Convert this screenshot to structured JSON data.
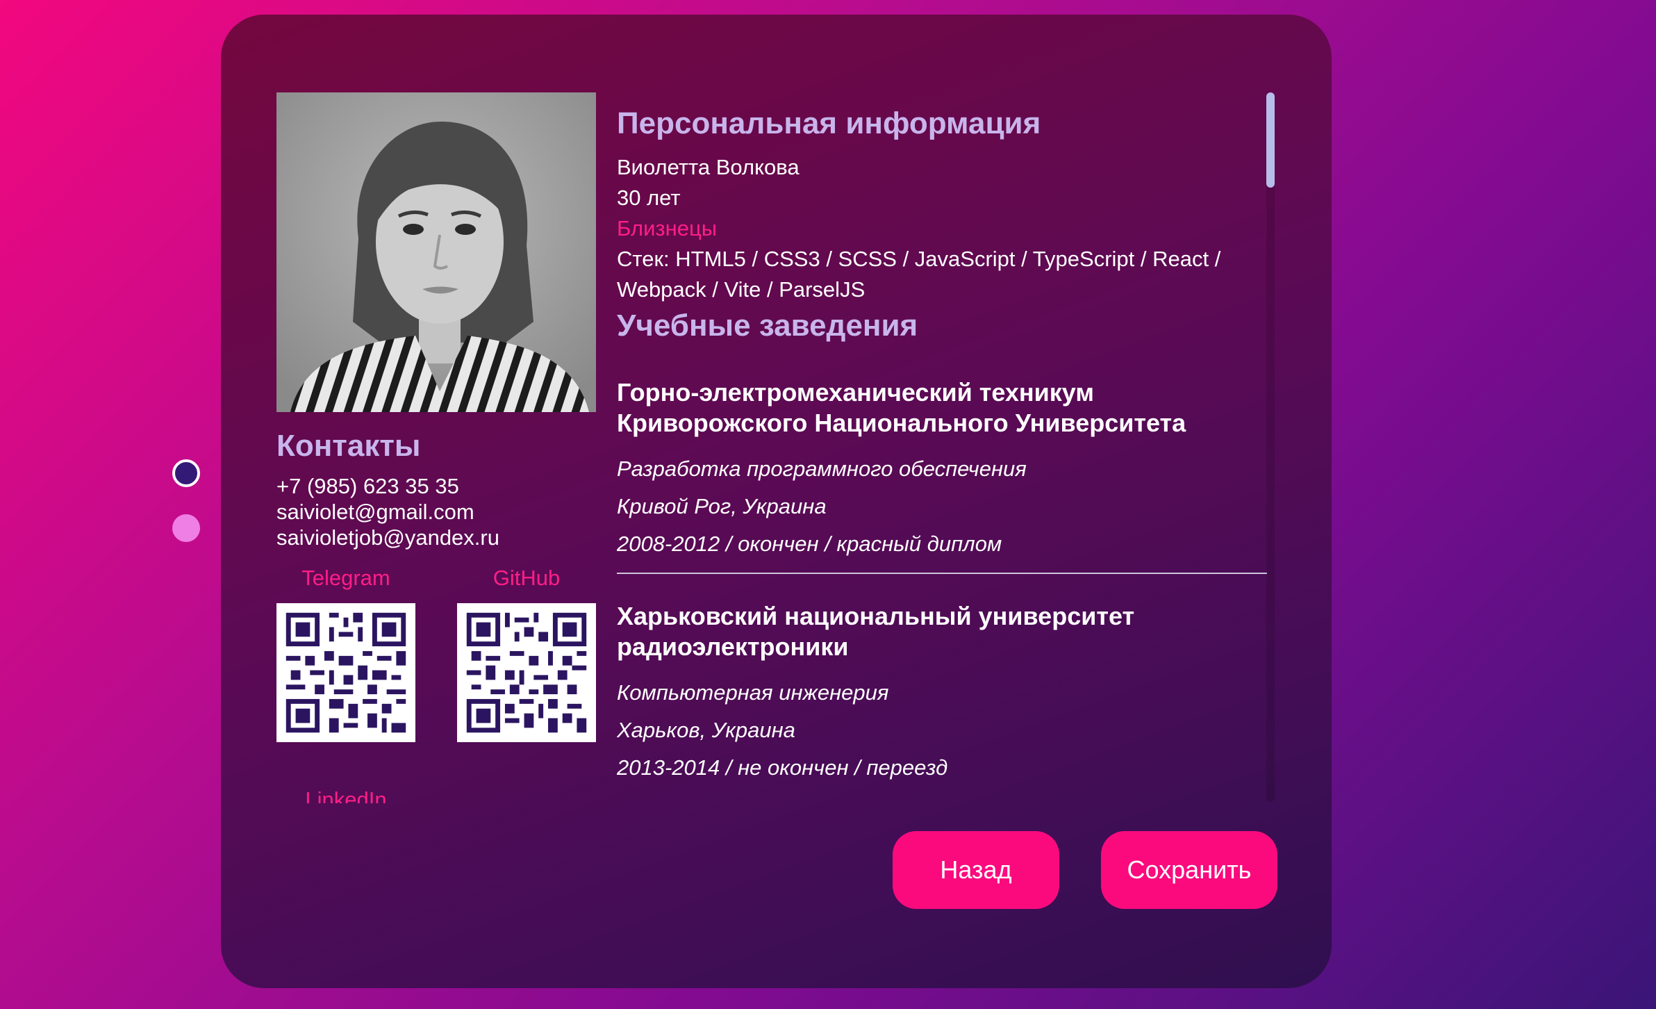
{
  "contacts": {
    "title": "Контакты",
    "phone": "+7 (985) 623 35 35",
    "email1": "saiviolet@gmail.com",
    "email2": "saivioletjob@yandex.ru",
    "telegram_label": "Telegram",
    "github_label": "GitHub",
    "linkedin_label": "LinkedIn"
  },
  "personal": {
    "title": "Персональная информация",
    "name": "Виолетта Волкова",
    "age": "30 лет",
    "zodiac": "Близнецы",
    "stack_line1": "Стек: HTML5 / CSS3 / SCSS / JavaScript / TypeScript / React /",
    "stack_line2": "Webpack / Vite / ParselJS"
  },
  "education": {
    "title": "Учебные заведения",
    "items": [
      {
        "name": "Горно-электромеханический техникум Криворожского Национального Университета",
        "specialty": "Разработка программного обеспечения",
        "location": "Кривой Рог, Украина",
        "period": "2008-2012 / окончен / красный диплом"
      },
      {
        "name": "Харьковский национальный университет радиоэлектроники",
        "specialty": "Компьютерная инженерия",
        "location": "Харьков, Украина",
        "period": "2013-2014 / не окончен / переезд"
      }
    ]
  },
  "buttons": {
    "back": "Назад",
    "save": "Сохранить"
  },
  "colors": {
    "accent": "#fb0a7e",
    "heading": "#c8b5ec",
    "qr_ink": "#2b1560"
  },
  "pagination": {
    "total": 2,
    "active": 1
  }
}
